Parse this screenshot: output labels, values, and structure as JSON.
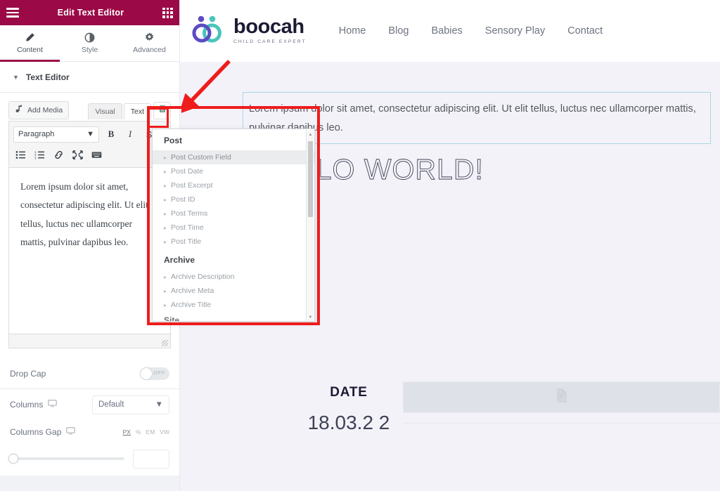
{
  "panel": {
    "header": {
      "title": "Edit Text Editor",
      "menu_icon": "hamburger-icon",
      "apps_icon": "grid-icon"
    },
    "tabs": [
      {
        "label": "Content",
        "icon": "pencil-icon",
        "active": true
      },
      {
        "label": "Style",
        "icon": "contrast-icon",
        "active": false
      },
      {
        "label": "Advanced",
        "icon": "gear-icon",
        "active": false
      }
    ],
    "section": {
      "title": "Text Editor",
      "caret": "▼"
    },
    "wp_editor": {
      "add_media_label": "Add Media",
      "add_media_icon": "media-icon",
      "visual_tab": "Visual",
      "text_tab": "Text",
      "dynamic_tags_icon": "database-icon",
      "format_select": "Paragraph",
      "bold_label": "B",
      "italic_label": "I",
      "toolbar_icons": [
        "bullet-list-icon",
        "numbered-list-icon",
        "link-icon",
        "fullscreen-icon",
        "keyboard-icon"
      ],
      "content": "Lorem ipsum dolor sit amet, consectetur adipiscing elit. Ut elit tellus, luctus nec ullamcorper mattis, pulvinar dapibus leo."
    },
    "controls": {
      "drop_cap": {
        "label": "Drop Cap",
        "state": "OFF"
      },
      "columns": {
        "label": "Columns",
        "value": "Default",
        "device_icon": "monitor-icon"
      },
      "columns_gap": {
        "label": "Columns Gap",
        "device_icon": "monitor-icon",
        "units": [
          "PX",
          "%",
          "EM",
          "VW"
        ],
        "active_unit": "PX",
        "value": ""
      }
    }
  },
  "dynamic_tags": {
    "groups": [
      {
        "title": "Post",
        "items": [
          {
            "label": "Post Custom Field",
            "selected": true
          },
          {
            "label": "Post Date",
            "selected": false
          },
          {
            "label": "Post Excerpt",
            "selected": false
          },
          {
            "label": "Post ID",
            "selected": false
          },
          {
            "label": "Post Terms",
            "selected": false
          },
          {
            "label": "Post Time",
            "selected": false
          },
          {
            "label": "Post Title",
            "selected": false
          }
        ]
      },
      {
        "title": "Archive",
        "items": [
          {
            "label": "Archive Description",
            "selected": false
          },
          {
            "label": "Archive Meta",
            "selected": false
          },
          {
            "label": "Archive Title",
            "selected": false
          }
        ]
      },
      {
        "title": "Site",
        "items": []
      }
    ]
  },
  "preview": {
    "site": {
      "brand_name": "boocah",
      "brand_tagline": "CHILD CARE EXPERT",
      "logo_icon": "boocah-logo-icon",
      "nav": [
        {
          "label": "Home"
        },
        {
          "label": "Blog"
        },
        {
          "label": "Babies"
        },
        {
          "label": "Sensory Play"
        },
        {
          "label": "Contact"
        }
      ]
    },
    "text_widget": "Lorem ipsum dolor sit amet, consectetur adipiscing elit. Ut elit tellus, luctus nec ullamcorper mattis, pulvinar dapibus leo.",
    "heading": "HELLO WORLD!",
    "date_label": "DATE",
    "date_value": "18.03.2 2",
    "media_placeholder_icon": "document-icon"
  },
  "annotations": {
    "arrow_color": "#ef1c1c",
    "box_color": "#ef1c1c"
  },
  "colors": {
    "panel_header": "#9b0a46",
    "accent": "#9b0a46",
    "logo_purple": "#5b4bc4",
    "logo_teal": "#49c5bd",
    "preview_bg": "#f3f2f9"
  }
}
